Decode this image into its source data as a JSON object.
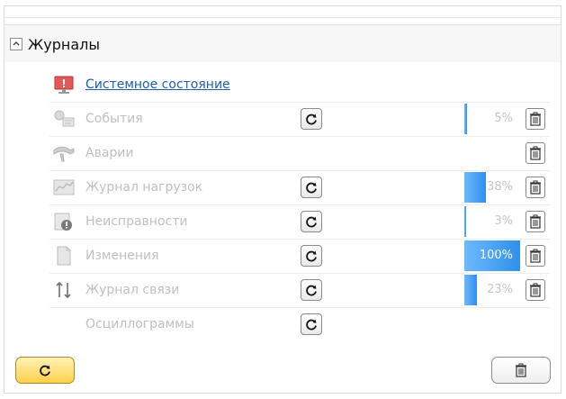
{
  "header": {
    "title": "Журналы"
  },
  "items": [
    {
      "label": "Системное состояние",
      "style": "link",
      "icon": "system-state-icon"
    },
    {
      "label": "События",
      "icon": "events-icon",
      "progress_text": "5%",
      "progress": 0.05
    },
    {
      "label": "Аварии",
      "icon": "alarms-icon"
    },
    {
      "label": "Журнал нагрузок",
      "icon": "load-log-icon",
      "progress_text": "38%",
      "progress": 0.38
    },
    {
      "label": "Неисправности",
      "icon": "faults-icon",
      "progress_text": "3%",
      "progress": 0.03
    },
    {
      "label": "Изменения",
      "icon": "changes-icon",
      "progress_text": "100%",
      "progress": 1.0
    },
    {
      "label": "Журнал связи",
      "icon": "connection-log-icon",
      "progress_text": "23%",
      "progress": 0.23
    },
    {
      "label": "Осциллограммы",
      "icon": "oscillograms-icon"
    }
  ],
  "colors": {
    "link": "#1f5fa8",
    "progress_fill": "#2f8fe9",
    "primary_button": "#ffd04b"
  }
}
